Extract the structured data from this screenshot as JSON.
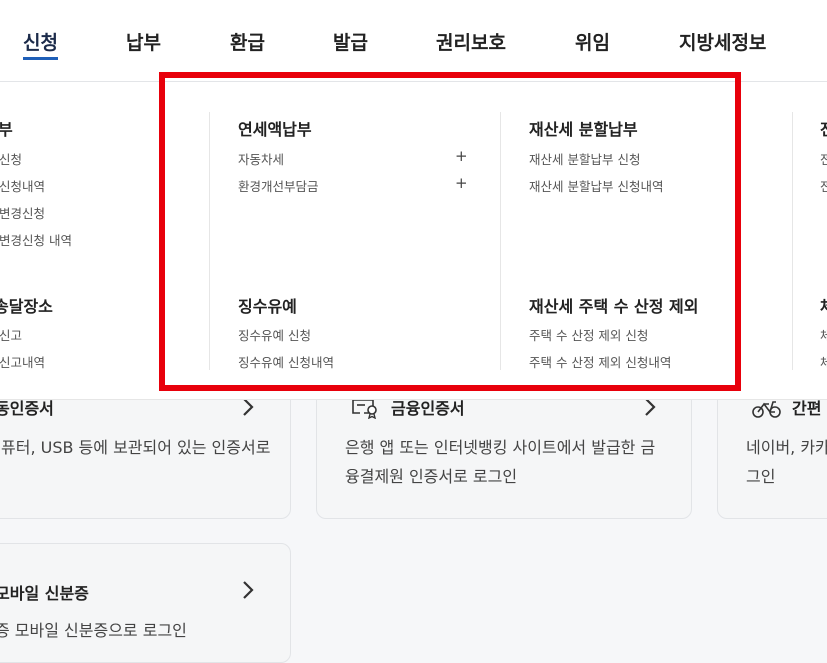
{
  "nav": {
    "tabs": [
      "신청",
      "납부",
      "환급",
      "발급",
      "권리보호",
      "위임",
      "지방세정보"
    ]
  },
  "menu": {
    "left_col": {
      "group1_title": "부",
      "group1_items": [
        "신청",
        "신청내역",
        "변경신청",
        "변경신청 내역"
      ],
      "group2_title": "송달장소",
      "group2_items": [
        "신고",
        "신고내역"
      ]
    },
    "col1": {
      "group1_title": "연세액납부",
      "group1_items": [
        "자동차세",
        "환경개선부담금"
      ],
      "group2_title": "징수유예",
      "group2_items": [
        "징수유예 신청",
        "징수유예 신청내역"
      ]
    },
    "col2": {
      "group1_title": "재산세 분할납부",
      "group1_items": [
        "재산세 분할납부 신청",
        "재산세 분할납부 신청내역"
      ],
      "group2_title": "재산세 주택 수 산정 제외",
      "group2_items": [
        "주택 수 산정 제외 신청",
        "주택 수 산정 제외 신청내역"
      ]
    },
    "right_col": {
      "group1_title": "전",
      "group1_items": [
        "전",
        "전"
      ],
      "group2_title": "체",
      "group2_items": [
        "체",
        "체"
      ]
    }
  },
  "cards": {
    "card1": {
      "title": "동인증서",
      "desc": [
        "퓨터, USB 등에 보관되어 있는 인증서로"
      ]
    },
    "card2": {
      "title": "금융인증서",
      "desc": [
        "은행 앱 또는 인터넷뱅킹 사이트에서 발급한 금",
        "융결제원 인증서로 로그인"
      ]
    },
    "card3": {
      "title": "간편",
      "desc": [
        "네이버, 카카",
        "그인"
      ]
    },
    "card4": {
      "title": "모바일 신분증",
      "desc": [
        "증 모바일 신분증으로 로그인"
      ]
    }
  },
  "colors": {
    "active_underline": "#1f5fb8",
    "highlight_box": "#e8000b"
  }
}
